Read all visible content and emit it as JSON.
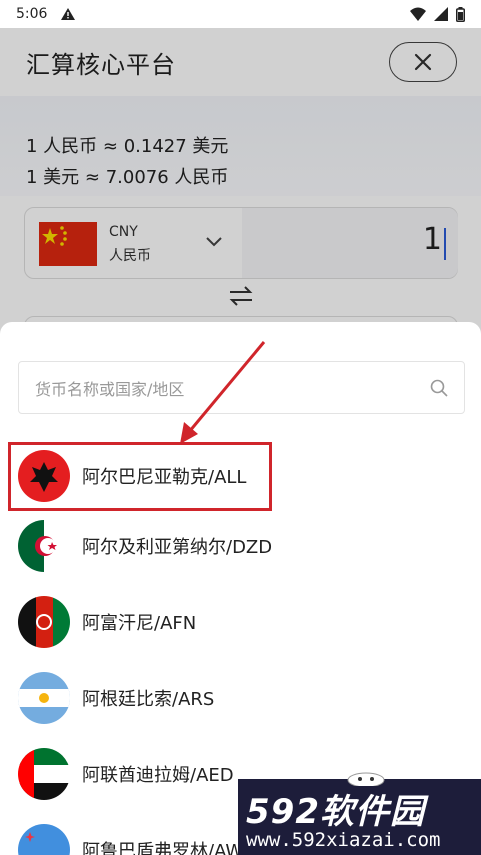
{
  "status_bar": {
    "time": "5:06"
  },
  "header": {
    "title": "汇算核心平台"
  },
  "rates": {
    "line1": "1 人民币 ≈ 0.1427 美元",
    "line2": "1 美元 ≈ 7.0076 人民币"
  },
  "from_currency": {
    "code": "CNY",
    "name": "人民币",
    "amount": "1"
  },
  "sheet": {
    "search_placeholder": "货币名称或国家/地区",
    "items": [
      {
        "label": "阿尔巴尼亚勒克/ALL",
        "flag": "albania-flag-icon"
      },
      {
        "label": "阿尔及利亚第纳尔/DZD",
        "flag": "algeria-flag-icon"
      },
      {
        "label": "阿富汗尼/AFN",
        "flag": "afghanistan-flag-icon"
      },
      {
        "label": "阿根廷比索/ARS",
        "flag": "argentina-flag-icon"
      },
      {
        "label": "阿联酋迪拉姆/AED",
        "flag": "uae-flag-icon"
      },
      {
        "label": "阿鲁巴盾弗罗林/AWG",
        "flag": "aruba-flag-icon"
      }
    ]
  },
  "watermark": {
    "brand": "592软件园",
    "url": "www.592xiazai.com"
  },
  "colors": {
    "highlight": "#d0252b",
    "accent": "#2a5bd7"
  }
}
